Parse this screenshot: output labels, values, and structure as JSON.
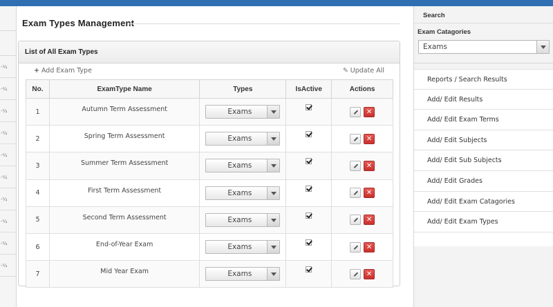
{
  "page": {
    "title": "Exam Types Management"
  },
  "panel": {
    "heading": "List of All Exam Types",
    "add_label": "Add Exam Type",
    "update_label": "Update All"
  },
  "table": {
    "headers": [
      "No.",
      "ExamType Name",
      "Types",
      "IsActive",
      "Actions"
    ],
    "rows": [
      {
        "no": "1",
        "name": "Autumn Term Assessment",
        "type": "Exams",
        "active": true
      },
      {
        "no": "2",
        "name": "Spring Term Assessment",
        "type": "Exams",
        "active": true
      },
      {
        "no": "3",
        "name": "Summer Term Assessment",
        "type": "Exams",
        "active": true
      },
      {
        "no": "4",
        "name": "First Term Assessment",
        "type": "Exams",
        "active": true
      },
      {
        "no": "5",
        "name": "Second Term Assessment",
        "type": "Exams",
        "active": true
      },
      {
        "no": "6",
        "name": "End-of-Year Exam",
        "type": "Exams",
        "active": true
      },
      {
        "no": "7",
        "name": "Mid Year Exam",
        "type": "Exams",
        "active": true
      }
    ],
    "delete_glyph": "✕"
  },
  "left_strip": {
    "cell_text": "-¼",
    "row_count": 10
  },
  "sidebar": {
    "search_title": "Search",
    "category_label": "Exam Catagories",
    "category_value": "Exams",
    "menu": [
      "Reports / Search Results",
      "Add/ Edit Results",
      "Add/ Edit Exam Terms",
      "Add/ Edit Subjects",
      "Add/ Edit Sub Subjects",
      "Add/ Edit Grades",
      "Add/ Edit Exam Catagories",
      "Add/ Edit Exam Types"
    ]
  },
  "colors": {
    "topbar": "#2f6fb2",
    "delete": "#d9534f"
  },
  "icons": {
    "add": "plus-icon",
    "update": "pencil-icon",
    "edit": "pencil-icon",
    "delete": "close-icon",
    "dropdown": "chevron-down-icon",
    "active": "checkbox-icon"
  }
}
